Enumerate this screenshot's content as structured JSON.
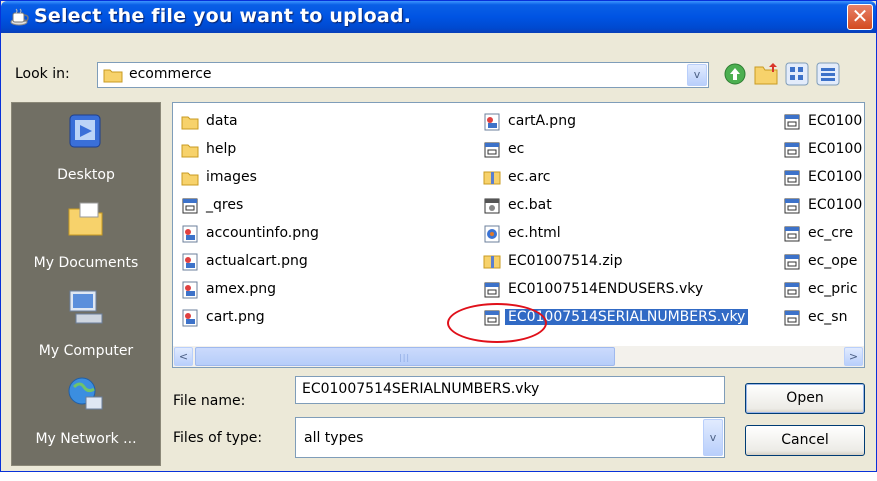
{
  "window": {
    "title": "Select the file you want to upload.",
    "close_glyph": "✕"
  },
  "lookin": {
    "label": "Look in:",
    "value": "ecommerce"
  },
  "toolbar": [
    "back-icon",
    "up-folder-icon",
    "new-folder-icon",
    "views-menu-icon"
  ],
  "places": [
    {
      "label": "Desktop",
      "icon": "desktop-icon"
    },
    {
      "label": "My Documents",
      "icon": "my-documents-icon"
    },
    {
      "label": "My Computer",
      "icon": "my-computer-icon"
    },
    {
      "label": "My Network ...",
      "icon": "my-network-icon"
    }
  ],
  "files": {
    "col1": [
      {
        "name": "data",
        "icon": "folder"
      },
      {
        "name": "help",
        "icon": "folder"
      },
      {
        "name": "images",
        "icon": "folder"
      },
      {
        "name": "_qres",
        "icon": "file-generic"
      },
      {
        "name": "accountinfo.png",
        "icon": "image"
      },
      {
        "name": "actualcart.png",
        "icon": "image"
      },
      {
        "name": "amex.png",
        "icon": "image"
      },
      {
        "name": "cart.png",
        "icon": "image"
      }
    ],
    "col2": [
      {
        "name": "cartA.png",
        "icon": "image"
      },
      {
        "name": "ec",
        "icon": "file-generic"
      },
      {
        "name": "ec.arc",
        "icon": "archive"
      },
      {
        "name": "ec.bat",
        "icon": "batch"
      },
      {
        "name": "ec.html",
        "icon": "html"
      },
      {
        "name": "EC01007514.zip",
        "icon": "archive"
      },
      {
        "name": "EC01007514ENDUSERS.vky",
        "icon": "file-generic"
      },
      {
        "name": "EC01007514SERIALNUMBERS.vky",
        "icon": "file-generic",
        "selected": true
      }
    ],
    "col3": [
      {
        "name": "EC0100",
        "icon": "file-generic"
      },
      {
        "name": "EC0100",
        "icon": "file-generic"
      },
      {
        "name": "EC0100",
        "icon": "file-generic"
      },
      {
        "name": "EC0100",
        "icon": "file-generic"
      },
      {
        "name": "ec_cre",
        "icon": "file-generic"
      },
      {
        "name": "ec_ope",
        "icon": "file-generic"
      },
      {
        "name": "ec_pric",
        "icon": "file-generic"
      },
      {
        "name": "ec_sn",
        "icon": "file-generic"
      }
    ]
  },
  "scrollbar": {
    "left_glyph": "<",
    "right_glyph": ">",
    "grip": "|||"
  },
  "filename": {
    "label": "File name:",
    "value": "EC01007514SERIALNUMBERS.vky"
  },
  "filetype": {
    "label": "Files of type:",
    "value": "all types"
  },
  "buttons": {
    "open": "Open",
    "cancel": "Cancel"
  },
  "dropdown_glyph": "v",
  "colors": {
    "selection": "#316ac5",
    "annotation": "#e0101a",
    "titlebar": "#0054e3"
  }
}
